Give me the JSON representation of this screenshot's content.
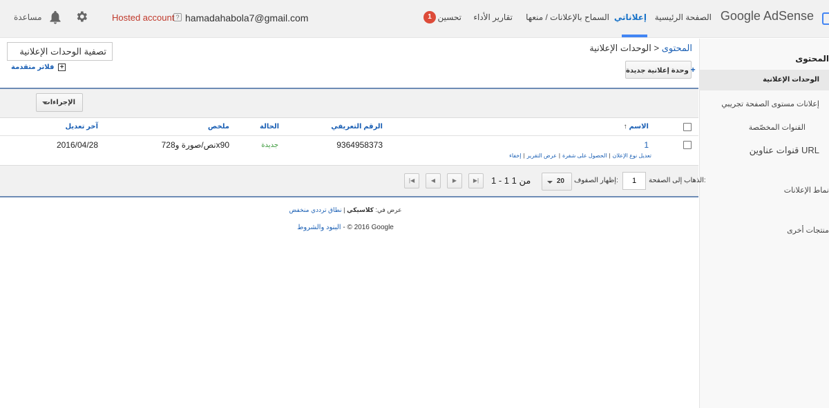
{
  "header": {
    "logo": "Google AdSense",
    "nav": [
      {
        "label": "الصفحة الرئيسية"
      },
      {
        "label": "إعلاناتي"
      },
      {
        "label": "السماح بالإعلانات / منعها"
      },
      {
        "label": "تقارير الأداء"
      },
      {
        "label": "تحسين"
      }
    ],
    "optimize_badge": "1",
    "email": "hamadahabola7@gmail.com",
    "help_mark": "?",
    "hosted_account": "Hosted account",
    "help_label": "مساعدة"
  },
  "sidebar": {
    "heading": "المحتوى",
    "items": [
      {
        "label": "الوحدات الإعلانية"
      },
      {
        "label": "إعلانات مستوى الصفحة تجريبي"
      },
      {
        "label": "القنوات المخصّصة"
      },
      {
        "label": "قنوات عناوين URL"
      },
      {
        "label": "نماط الإعلانات"
      },
      {
        "label": "منتجات أخرى"
      }
    ]
  },
  "breadcrumb": {
    "parent": "المحتوى",
    "separator": "<",
    "current": "الوحدات الإعلانية"
  },
  "toolbar": {
    "new_unit_label": "وحدة إعلانية جديدة",
    "new_unit_plus": "+",
    "filter_value": "تصفية الوحدات الإعلانية",
    "advanced_filters": "فلاتر متقدمة",
    "advanced_plus": "+",
    "actions_label": "الإجراءات"
  },
  "table": {
    "columns": {
      "name": "الاسم",
      "id": "الرقم التعريفي",
      "status": "الحالة",
      "summary": "ملخص",
      "modified": "آخر تعديل"
    },
    "sort_arrow": "↑",
    "rows": [
      {
        "name": "1",
        "id": "9364958373",
        "status": "جديدة",
        "summary": "نص/صورة و728x90",
        "modified": "2016/04/28",
        "links": [
          "تعديل نوع الإعلان",
          "الحصول على شفرة",
          "عرض التقرير",
          "إخفاء"
        ],
        "link_separator": "|"
      }
    ]
  },
  "pager": {
    "goto_label": "الذهاب إلى الصفحة:",
    "goto_value": "1",
    "rows_label": "إظهار الصفوف:",
    "rows_value": "20",
    "range": "1 - 1 من 1"
  },
  "footer": {
    "view_in": "عرض في:",
    "classic": "كلاسيكي",
    "separator": "|",
    "low_bandwidth": "نطاق ترددي منخفض",
    "terms": "البنود والشروط",
    "dash": "-",
    "copyright": "© 2016 Google"
  }
}
